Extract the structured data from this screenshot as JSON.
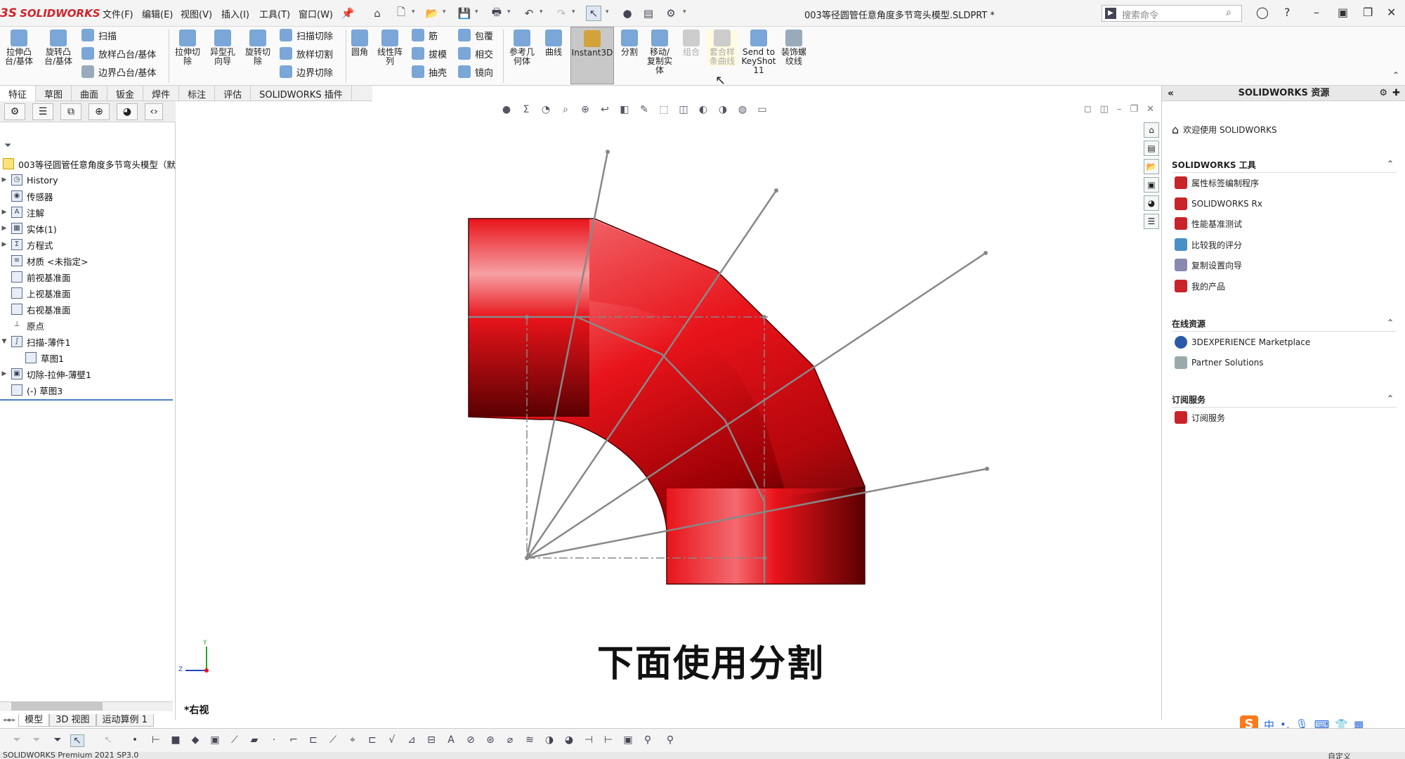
{
  "app": {
    "logo_text": "SOLIDWORKS",
    "doc_title": "003等径圆管任意角度多节弯头模型.SLDPRT *",
    "search_placeholder": "搜索命令"
  },
  "menu": [
    "文件(F)",
    "编辑(E)",
    "视图(V)",
    "插入(I)",
    "工具(T)",
    "窗口(W)"
  ],
  "ribbon": {
    "extrude_boss": "拉伸凸\n台/基体",
    "revolve_boss": "旋转凸\n台/基体",
    "sweep": "扫描",
    "loft_boss": "放样凸台/基体",
    "boundary_boss": "边界凸台/基体",
    "extrude_cut": "拉伸切\n除",
    "hole_wizard": "异型孔\n向导",
    "revolve_cut": "旋转切\n除",
    "sweep_cut": "扫描切除",
    "loft_cut": "放样切割",
    "boundary_cut": "边界切除",
    "fillet": "圆角",
    "linear_pattern": "线性阵\n列",
    "rib": "筋",
    "draft": "拔模",
    "shell": "抽壳",
    "wrap": "包覆",
    "intersect": "相交",
    "mirror": "镜向",
    "ref_geometry": "参考几\n何体",
    "curves": "曲线",
    "instant3d": "Instant3D",
    "split": "分割",
    "move_copy": "移动/\n复制实\n体",
    "combine": "组合",
    "intersection_curve": "套合样\n条曲线",
    "keyshot": "Send to\nKeyShot\n11",
    "cosmetic_thread": "装饰螺\n纹线"
  },
  "tabs": [
    "特征",
    "草图",
    "曲面",
    "钣金",
    "焊件",
    "标注",
    "评估",
    "SOLIDWORKS 插件"
  ],
  "tree": {
    "root": "003等径圆管任意角度多节弯头模型（默",
    "items": [
      "History",
      "传感器",
      "注解",
      "实体(1)",
      "方程式",
      "材质 <未指定>",
      "前视基准面",
      "上视基准面",
      "右视基准面",
      "原点",
      "扫描-薄件1",
      "草图1",
      "切除-拉伸-薄壁1",
      "(-) 草图3"
    ]
  },
  "viewport": {
    "subtitle": "下面使用分割",
    "view_label": "*右视",
    "axis_y": "Y",
    "axis_z": "Z"
  },
  "right_panel": {
    "title": "SOLIDWORKS 资源",
    "welcome": "欢迎使用 SOLIDWORKS",
    "tools_header": "SOLIDWORKS 工具",
    "tools": [
      "属性标签编制程序",
      "SOLIDWORKS Rx",
      "性能基准测试",
      "比较我的评分",
      "复制设置向导",
      "我的产品"
    ],
    "online_header": "在线资源",
    "online": [
      "3DEXPERIENCE Marketplace",
      "Partner Solutions"
    ],
    "subscription_header": "订阅服务",
    "subscription": [
      "订阅服务"
    ]
  },
  "bottom_tabs": [
    "模型",
    "3D 视图",
    "运动算例 1"
  ],
  "status": {
    "left": "SOLIDWORKS Premium 2021 SP3.0",
    "right": "自定义"
  },
  "colors": {
    "pipe": "#e8141a",
    "accent": "#d2232a"
  }
}
